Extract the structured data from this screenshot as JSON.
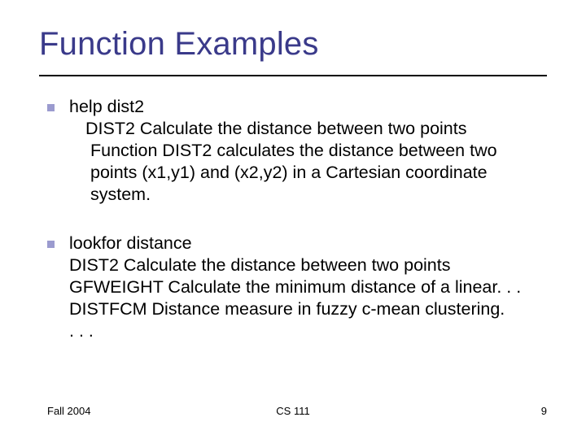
{
  "title": "Function Examples",
  "bullets": [
    {
      "cmd": "help dist2",
      "line1": "DIST2 Calculate the distance between two points",
      "rest": "Function DIST2 calculates the distance between two points (x1,y1) and (x2,y2) in a Cartesian coordinate system."
    },
    {
      "cmd": "lookfor distance",
      "lines": [
        "DIST2 Calculate the distance between two points",
        "GFWEIGHT Calculate the minimum distance of a linear. . .",
        "DISTFCM Distance measure in fuzzy c-mean clustering.",
        ". . ."
      ]
    }
  ],
  "footer": {
    "left": "Fall 2004",
    "center": "CS 111",
    "right": "9"
  }
}
